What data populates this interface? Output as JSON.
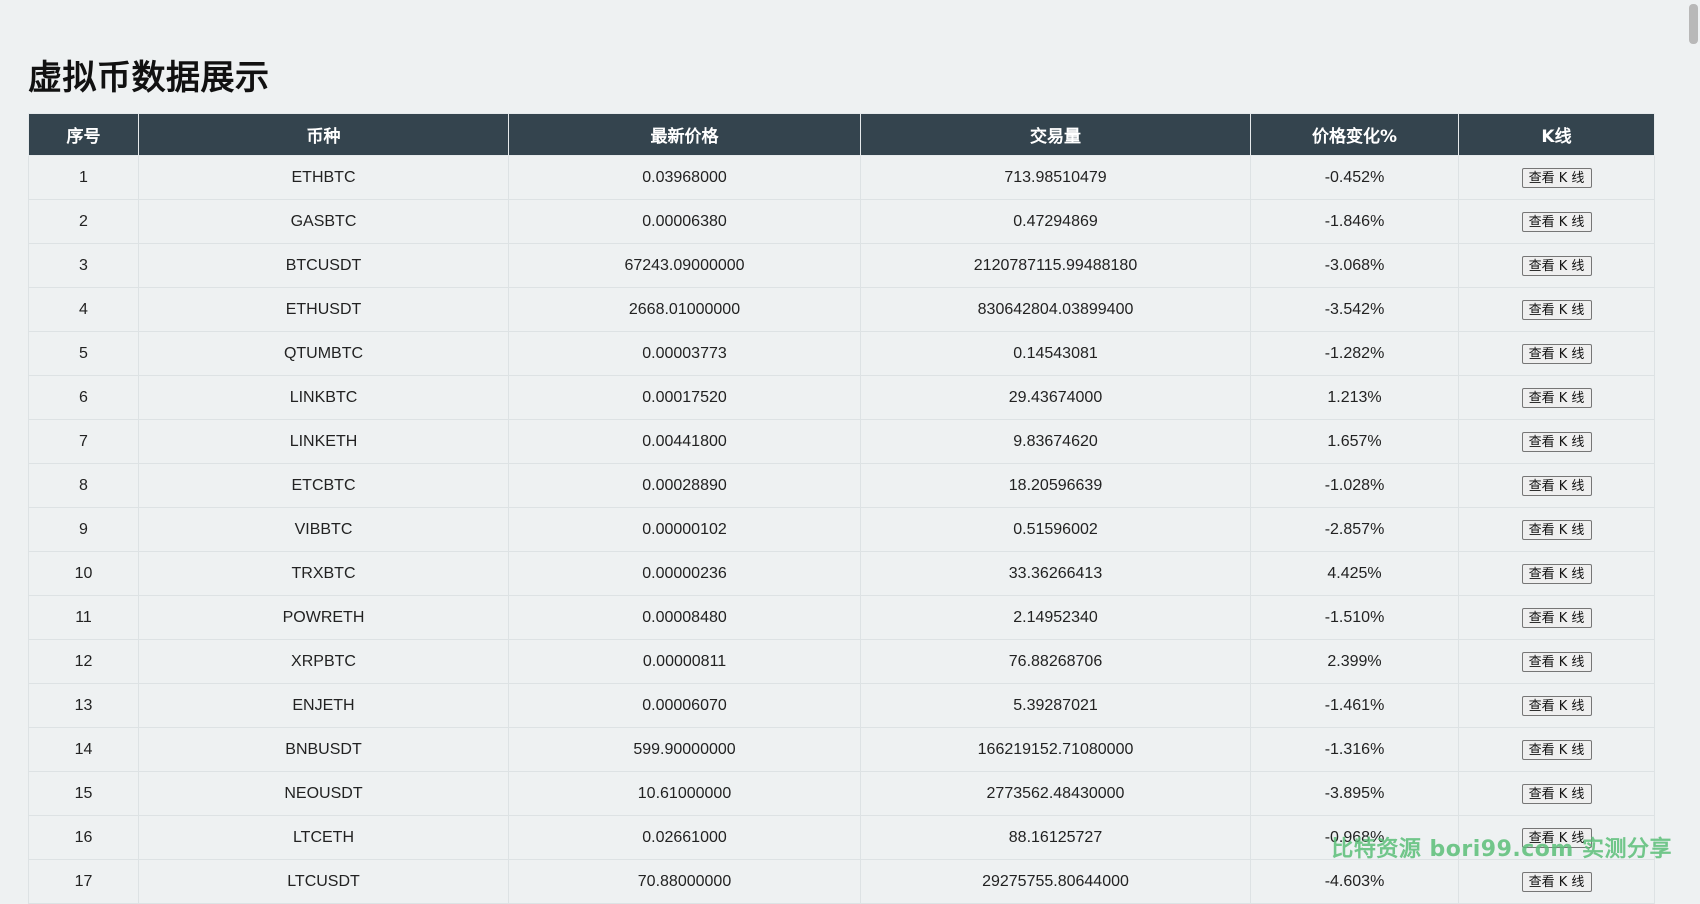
{
  "page": {
    "title": "虚拟币数据展示"
  },
  "table": {
    "headers": [
      "序号",
      "币种",
      "最新价格",
      "交易量",
      "价格变化%",
      "K线"
    ],
    "button_label": "查看 K 线",
    "rows": [
      [
        "1",
        "ETHBTC",
        "0.03968000",
        "713.98510479",
        "-0.452%"
      ],
      [
        "2",
        "GASBTC",
        "0.00006380",
        "0.47294869",
        "-1.846%"
      ],
      [
        "3",
        "BTCUSDT",
        "67243.09000000",
        "2120787115.99488180",
        "-3.068%"
      ],
      [
        "4",
        "ETHUSDT",
        "2668.01000000",
        "830642804.03899400",
        "-3.542%"
      ],
      [
        "5",
        "QTUMBTC",
        "0.00003773",
        "0.14543081",
        "-1.282%"
      ],
      [
        "6",
        "LINKBTC",
        "0.00017520",
        "29.43674000",
        "1.213%"
      ],
      [
        "7",
        "LINKETH",
        "0.00441800",
        "9.83674620",
        "1.657%"
      ],
      [
        "8",
        "ETCBTC",
        "0.00028890",
        "18.20596639",
        "-1.028%"
      ],
      [
        "9",
        "VIBBTC",
        "0.00000102",
        "0.51596002",
        "-2.857%"
      ],
      [
        "10",
        "TRXBTC",
        "0.00000236",
        "33.36266413",
        "4.425%"
      ],
      [
        "11",
        "POWRETH",
        "0.00008480",
        "2.14952340",
        "-1.510%"
      ],
      [
        "12",
        "XRPBTC",
        "0.00000811",
        "76.88268706",
        "2.399%"
      ],
      [
        "13",
        "ENJETH",
        "0.00006070",
        "5.39287021",
        "-1.461%"
      ],
      [
        "14",
        "BNBUSDT",
        "599.90000000",
        "166219152.71080000",
        "-1.316%"
      ],
      [
        "15",
        "NEOUSDT",
        "10.61000000",
        "2773562.48430000",
        "-3.895%"
      ],
      [
        "16",
        "LTCETH",
        "0.02661000",
        "88.16125727",
        "-0.968%"
      ],
      [
        "17",
        "LTCUSDT",
        "70.88000000",
        "29275755.80644000",
        "-4.603%"
      ]
    ]
  },
  "watermark": {
    "text": "比特资源 bori99.com 实测分享"
  }
}
